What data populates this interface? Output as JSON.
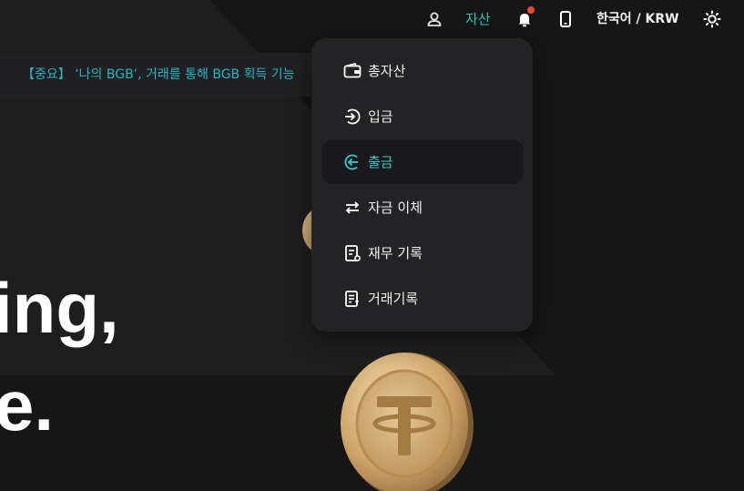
{
  "nav": {
    "assets_label": "자산",
    "language_label": "한국어 / KRW"
  },
  "announcement": {
    "text": "【중요】 ‘나의 BGB’, 거래를 통해 BGB 획득 기능"
  },
  "hero": {
    "line1": "ing,",
    "line2": "e."
  },
  "assets_menu": {
    "items": [
      {
        "label": "총자산",
        "icon": "wallet-icon"
      },
      {
        "label": "입금",
        "icon": "deposit-icon"
      },
      {
        "label": "출금",
        "icon": "withdraw-icon",
        "active": true
      },
      {
        "label": "자금 이체",
        "icon": "transfer-icon"
      },
      {
        "label": "재무 기록",
        "icon": "financial-record-icon"
      },
      {
        "label": "거래기록",
        "icon": "trade-record-icon"
      }
    ]
  },
  "colors": {
    "accent": "#27c4c4",
    "background": "#161616",
    "menu_bg": "#232325",
    "notification": "#f0462d"
  }
}
